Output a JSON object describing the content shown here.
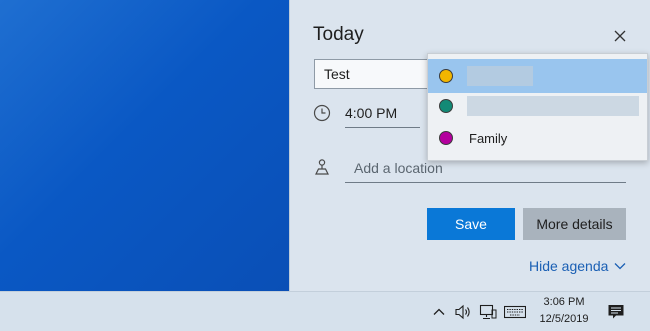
{
  "flyout": {
    "title": "Today",
    "event_title_value": "Test",
    "time_value": "4:00 PM",
    "location_placeholder": "Add a location",
    "save_label": "Save",
    "more_details_label": "More details",
    "hide_agenda_label": "Hide agenda"
  },
  "calendar_dropdown": {
    "items": [
      {
        "label": "",
        "color": "#f2b600",
        "selected": true
      },
      {
        "label": "",
        "color": "#138a76",
        "selected": false
      },
      {
        "label": "Family",
        "color": "#b4009e",
        "selected": false
      }
    ]
  },
  "taskbar": {
    "time": "3:06 PM",
    "date": "12/5/2019"
  },
  "colors": {
    "accent": "#0a78d7",
    "desktop": "#0a58c4"
  }
}
